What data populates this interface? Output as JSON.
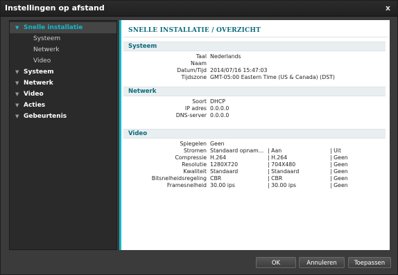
{
  "window": {
    "title": "Instellingen op afstand",
    "close_glyph": "x"
  },
  "sidebar": {
    "items": [
      {
        "label": "Snelle installatie",
        "expanded": true,
        "active": true,
        "children": [
          "Systeem",
          "Netwerk",
          "Video"
        ]
      },
      {
        "label": "Systeem"
      },
      {
        "label": "Netwerk"
      },
      {
        "label": "Video"
      },
      {
        "label": "Acties"
      },
      {
        "label": "Gebeurtenis"
      }
    ]
  },
  "main": {
    "heading": "SNELLE INSTALLATIE / OVERZICHT",
    "systeem": {
      "title": "Systeem",
      "rows": [
        {
          "label": "Taal",
          "value": "Nederlands"
        },
        {
          "label": "Naam",
          "value": ""
        },
        {
          "label": "Datum/Tijd",
          "value": "2014/07/16 15:47:03"
        },
        {
          "label": "Tijdszone",
          "value": "GMT-05:00 Eastern Time (US & Canada) (DST)"
        }
      ]
    },
    "netwerk": {
      "title": "Netwerk",
      "rows": [
        {
          "label": "Soort",
          "value": "DHCP"
        },
        {
          "label": "IP adres",
          "value": "0.0.0.0"
        },
        {
          "label": "DNS-server",
          "value": "0.0.0.0"
        }
      ]
    },
    "video": {
      "title": "Video",
      "spiegelen": {
        "label": "Spiegelen",
        "value": "Geen"
      },
      "rows": [
        {
          "label": "Stromen",
          "c1": "Standaard opnam...",
          "c2": "| Aan",
          "c3": "| Uit"
        },
        {
          "label": "Compressie",
          "c1": "H.264",
          "c2": "| H.264",
          "c3": "| Geen"
        },
        {
          "label": "Resolutie",
          "c1": "1280X720",
          "c2": "| 704X480",
          "c3": "| Geen"
        },
        {
          "label": "Kwaliteit",
          "c1": "Standaard",
          "c2": "| Standaard",
          "c3": "| Geen"
        },
        {
          "label": "Bitsnelheidsregeling",
          "c1": "CBR",
          "c2": "| CBR",
          "c3": "| Geen"
        },
        {
          "label": "Framesnelheid",
          "c1": "30.00 ips",
          "c2": "| 30.00 ips",
          "c3": "| Geen"
        }
      ]
    }
  },
  "footer": {
    "ok": "OK",
    "cancel": "Annuleren",
    "apply": "Toepassen"
  },
  "colors": {
    "accent": "#13b9c8",
    "section_title": "#0a6a7a",
    "background": "#3b3b3b"
  },
  "icons": {
    "expand": "triangle-down-icon",
    "close": "close-icon"
  }
}
